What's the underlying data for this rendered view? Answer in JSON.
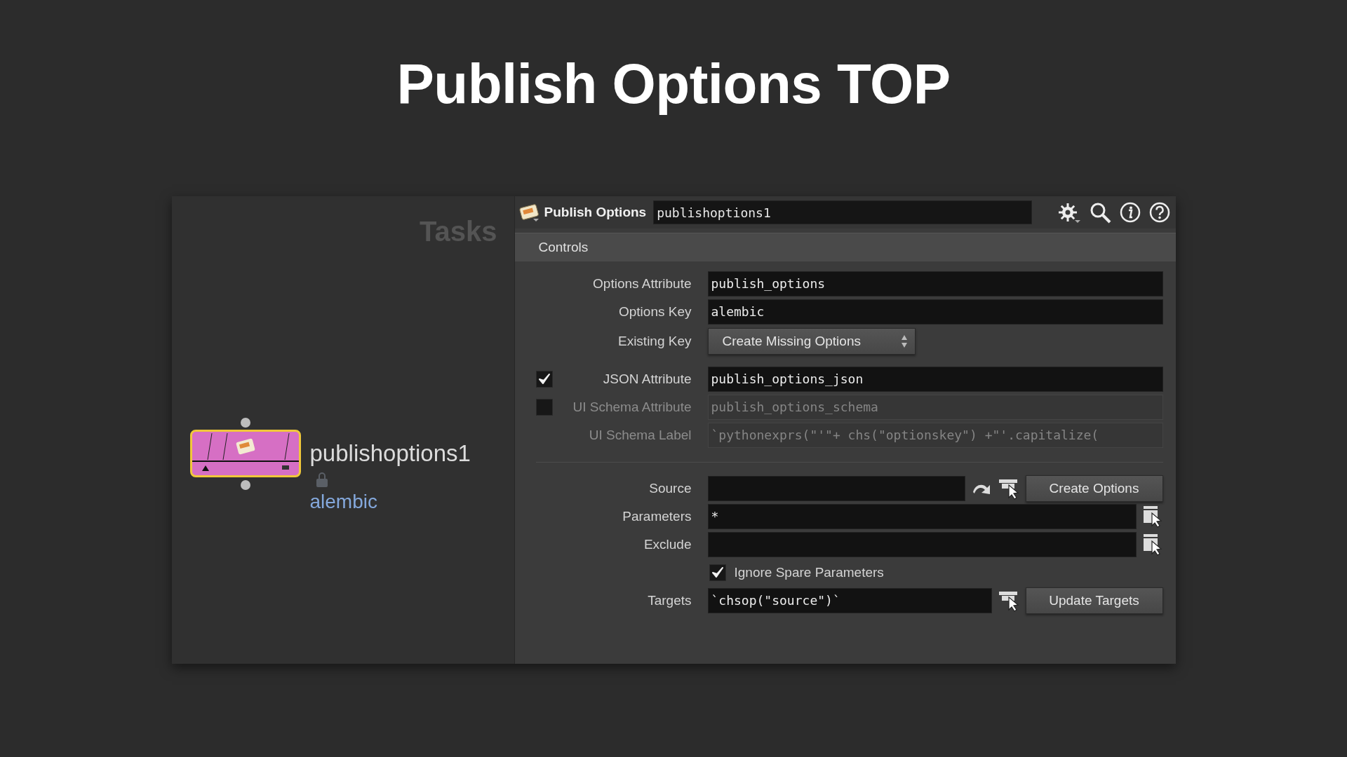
{
  "slide_title": "Publish Options TOP",
  "network": {
    "pane_label": "Tasks",
    "node": {
      "name": "publishoptions1",
      "tag": "alembic",
      "selected": true
    }
  },
  "parameters": {
    "node_type": "Publish Options",
    "node_name": "publishoptions1",
    "tabs": [
      {
        "label": "Controls",
        "selected": true
      }
    ],
    "rows": [
      {
        "kind": "field",
        "label": "Options Attribute",
        "value": "publish_options",
        "disabled": false
      },
      {
        "kind": "field",
        "label": "Options Key",
        "value": "alembic",
        "disabled": false
      },
      {
        "kind": "menu",
        "label": "Existing Key",
        "value": "Create Missing Options"
      },
      {
        "kind": "toggle_field",
        "label": "JSON Attribute",
        "value": "publish_options_json",
        "checked": true,
        "disabled": false
      },
      {
        "kind": "toggle_field",
        "label": "UI Schema Attribute",
        "value": "publish_options_schema",
        "checked": false,
        "disabled": true
      },
      {
        "kind": "field",
        "label": "UI Schema Label",
        "value": "`pythonexprs(\"'\"+ chs(\"optionskey\") +\"'.capitalize(",
        "disabled": true
      },
      {
        "kind": "separator"
      },
      {
        "kind": "field",
        "label": "Source",
        "value": "",
        "disabled": false,
        "extras": [
          {
            "kind": "jump"
          },
          {
            "kind": "picker"
          },
          {
            "kind": "button",
            "label": "Create Options"
          }
        ]
      },
      {
        "kind": "field",
        "label": "Parameters",
        "value": "*",
        "disabled": false,
        "extras": [
          {
            "kind": "select"
          }
        ]
      },
      {
        "kind": "field",
        "label": "Exclude",
        "value": "",
        "disabled": false,
        "extras": [
          {
            "kind": "select"
          }
        ]
      },
      {
        "kind": "checkbox",
        "label": "Ignore Spare Parameters",
        "checked": true
      },
      {
        "kind": "field",
        "label": "Targets",
        "value": "`chsop(\"source\")`",
        "disabled": false,
        "extras": [
          {
            "kind": "picker"
          },
          {
            "kind": "button",
            "label": "Update Targets"
          }
        ]
      }
    ]
  }
}
